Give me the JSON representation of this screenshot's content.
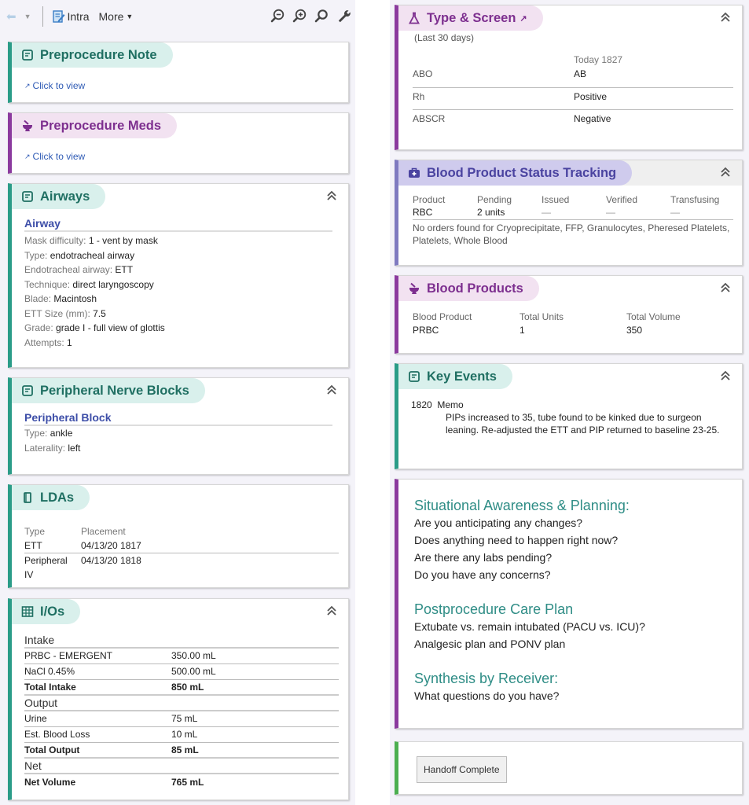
{
  "toolbar": {
    "back_icon": "back-arrow-icon",
    "intra_label": "Intra",
    "more_label": "More",
    "icons": [
      "zoom-out-icon",
      "zoom-in-icon",
      "search-icon",
      "wrench-icon"
    ]
  },
  "colors": {
    "teal_accent": "#2b9c88",
    "purple_accent": "#8b3a9e",
    "lavender_accent": "#7f7ac0",
    "green_accent": "#4caf50",
    "link_blue": "#2f5bb5",
    "section_blue": "#3d4ea8"
  },
  "left": {
    "preprocedure_note": {
      "title": "Preprocedure Note",
      "link": "Click to view"
    },
    "preprocedure_meds": {
      "title": "Preprocedure Meds",
      "link": "Click to view"
    },
    "airways": {
      "title": "Airways",
      "section": "Airway",
      "items": [
        {
          "k": "Mask difficulty:",
          "v": "1 - vent by mask"
        },
        {
          "k": "Type:",
          "v": "endotracheal airway"
        },
        {
          "k": "Endotracheal airway:",
          "v": "ETT"
        },
        {
          "k": "Technique:",
          "v": "direct laryngoscopy"
        },
        {
          "k": "Blade:",
          "v": "Macintosh"
        },
        {
          "k": "ETT Size (mm):",
          "v": "7.5"
        },
        {
          "k": "Grade:",
          "v": "grade I - full view of glottis"
        },
        {
          "k": "Attempts:",
          "v": "1"
        }
      ]
    },
    "nerve_blocks": {
      "title": "Peripheral Nerve Blocks",
      "section": "Peripheral Block",
      "items": [
        {
          "k": "Type:",
          "v": "ankle"
        },
        {
          "k": "Laterality:",
          "v": "left"
        }
      ]
    },
    "ldas": {
      "title": "LDAs",
      "headers": [
        "Type",
        "Placement"
      ],
      "rows": [
        [
          "ETT",
          "04/13/20 1817"
        ],
        [
          "Peripheral IV",
          "04/13/20 1818"
        ]
      ]
    },
    "ios": {
      "title": "I/Os",
      "intake_label": "Intake",
      "intake": [
        [
          "PRBC - EMERGENT",
          "350.00 mL"
        ],
        [
          "NaCl  0.45%",
          "500.00 mL"
        ]
      ],
      "total_intake": [
        "Total Intake",
        "850 mL"
      ],
      "output_label": "Output",
      "output": [
        [
          "Urine",
          "75 mL"
        ],
        [
          "Est. Blood Loss",
          "10 mL"
        ]
      ],
      "total_output": [
        "Total Output",
        "85 mL"
      ],
      "net_label": "Net",
      "net": [
        "Net Volume",
        "765 mL"
      ]
    }
  },
  "right": {
    "type_screen": {
      "title": "Type & Screen",
      "subtitle": "(Last 30 days)",
      "column": "Today 1827",
      "rows": [
        [
          "ABO",
          "AB"
        ],
        [
          "Rh",
          "Positive"
        ],
        [
          "ABSCR",
          "Negative"
        ]
      ]
    },
    "bpst": {
      "title": "Blood Product Status Tracking",
      "headers": [
        "Product",
        "Pending",
        "Issued",
        "Verified",
        "Transfusing"
      ],
      "row": [
        "RBC",
        "2 units",
        "—",
        "—",
        "—"
      ],
      "note": "No orders found for Cryoprecipitate, FFP, Granulocytes, Pheresed Platelets, Platelets, Whole Blood"
    },
    "blood_products": {
      "title": "Blood Products",
      "headers": [
        "Blood Product",
        "Total Units",
        "Total Volume"
      ],
      "row": [
        "PRBC",
        "1",
        "350"
      ]
    },
    "key_events": {
      "title": "Key Events",
      "time": "1820",
      "type": "Memo",
      "text": "PIPs increased to 35, tube found to be kinked due to surgeon leaning. Re-adjusted the ETT and PIP returned to baseline 23-25."
    },
    "situational": {
      "h1": "Situational Awareness & Planning:",
      "q1": [
        "Are you anticipating any changes?",
        "Does anything need to happen right now?",
        "Are there any labs pending?",
        "Do you have any concerns?"
      ],
      "h2": "Postprocedure Care Plan",
      "q2": [
        "Extubate vs. remain intubated (PACU vs. ICU)?",
        "Analgesic plan and PONV plan"
      ],
      "h3": "Synthesis by Receiver:",
      "q3": [
        "What questions do you have?"
      ]
    },
    "handoff": {
      "button_label": "Handoff Complete"
    }
  }
}
